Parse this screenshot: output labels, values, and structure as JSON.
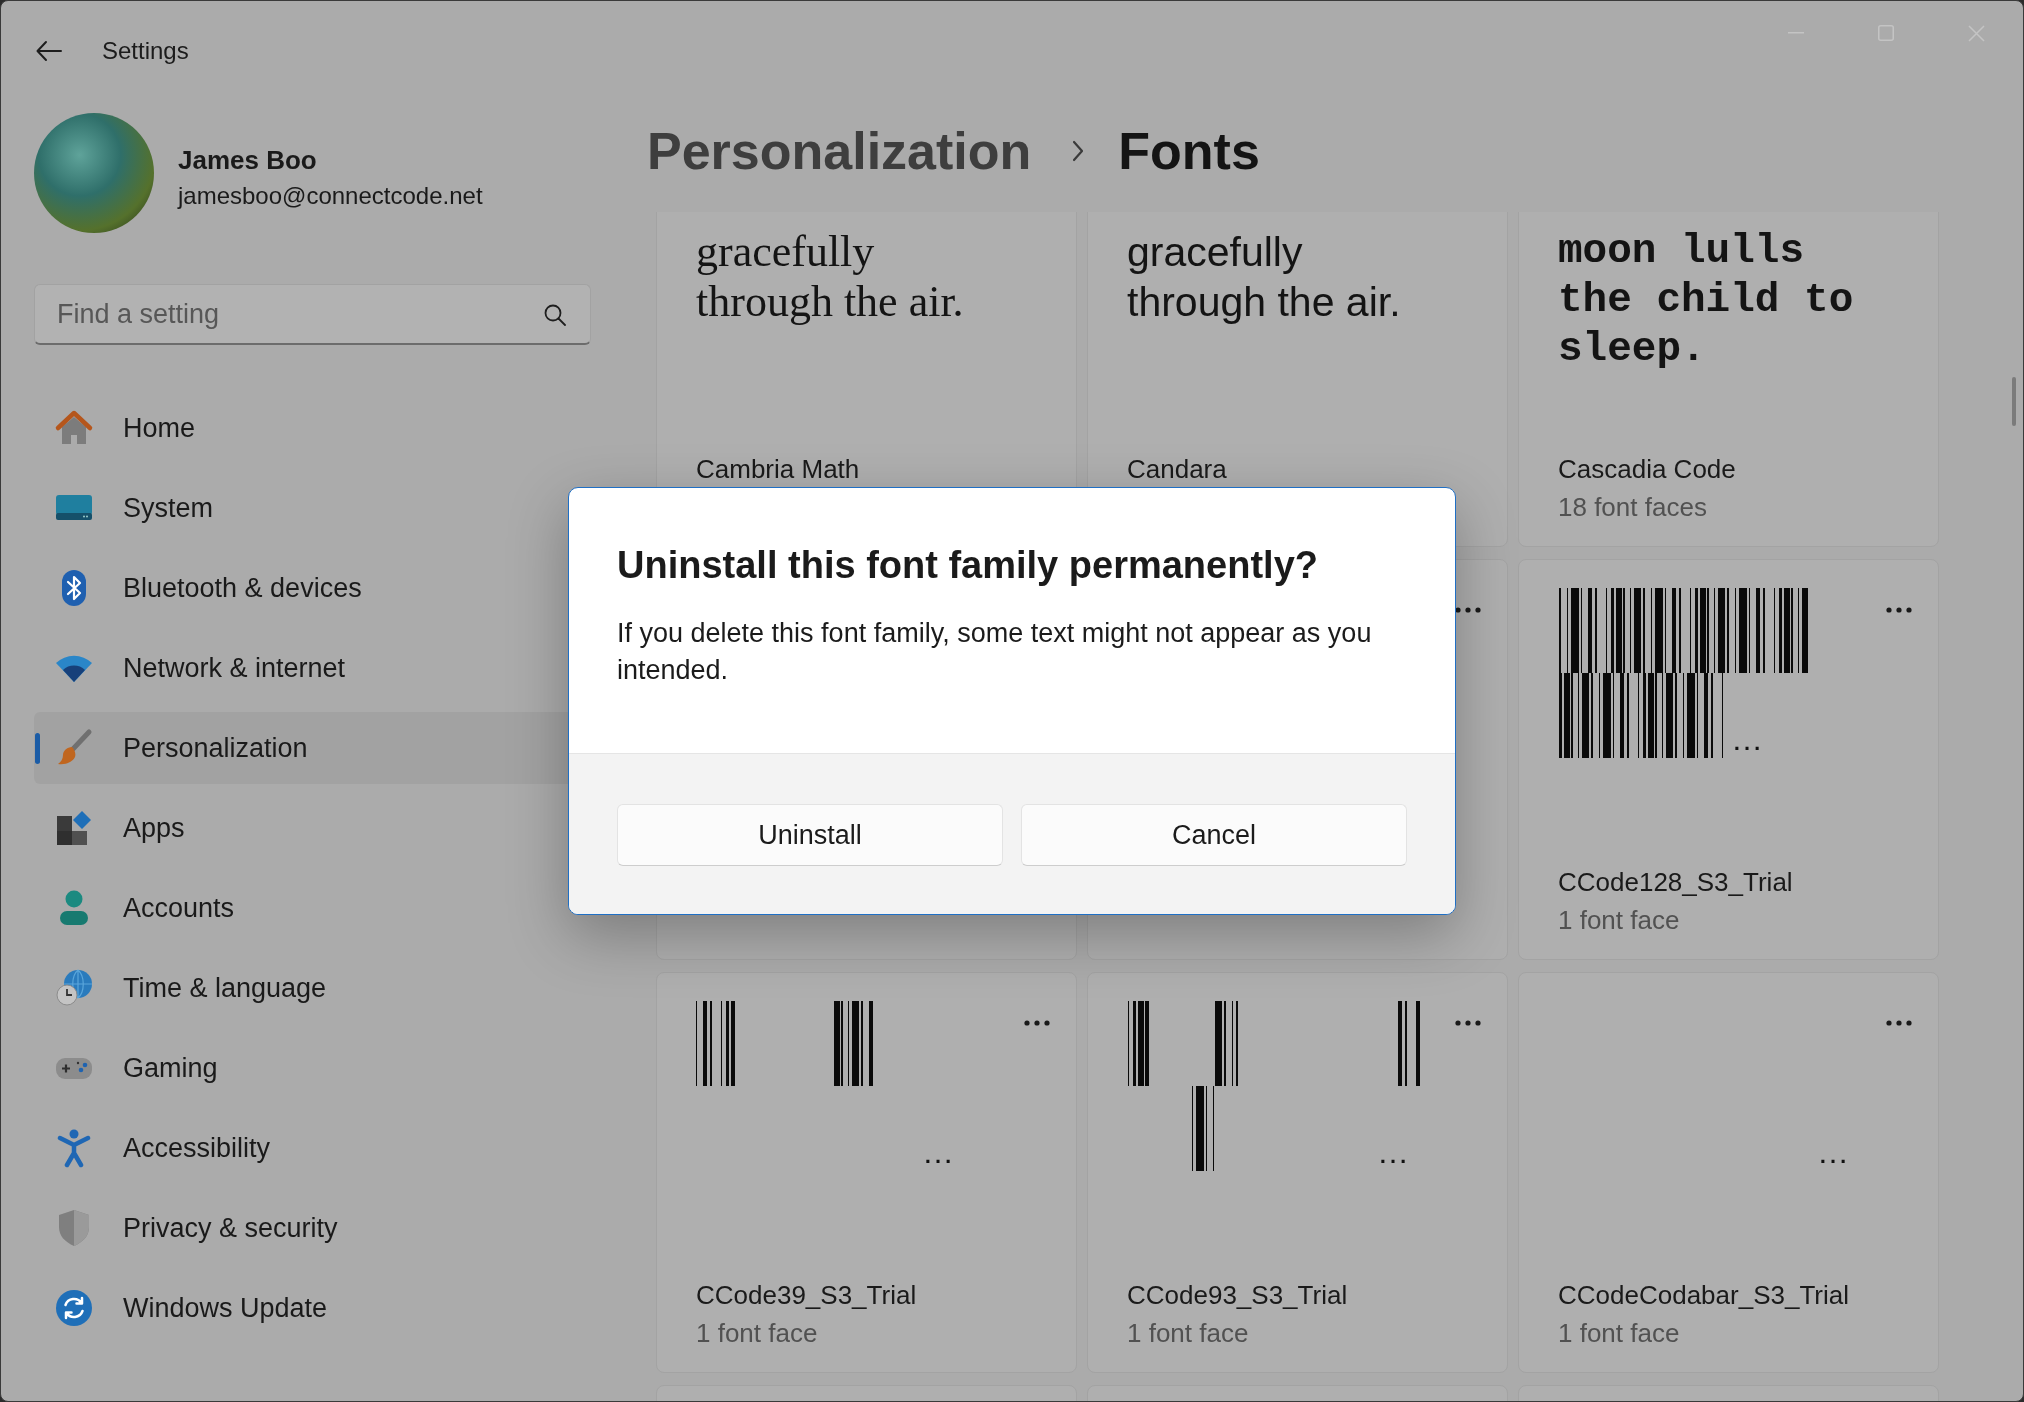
{
  "window": {
    "title": "Settings"
  },
  "profile": {
    "name": "James Boo",
    "email": "jamesboo@connectcode.net"
  },
  "search": {
    "placeholder": "Find a setting"
  },
  "sidebar": {
    "items": [
      {
        "label": "Home",
        "selected": false
      },
      {
        "label": "System",
        "selected": false
      },
      {
        "label": "Bluetooth & devices",
        "selected": false
      },
      {
        "label": "Network & internet",
        "selected": false
      },
      {
        "label": "Personalization",
        "selected": true
      },
      {
        "label": "Apps",
        "selected": false
      },
      {
        "label": "Accounts",
        "selected": false
      },
      {
        "label": "Time & language",
        "selected": false
      },
      {
        "label": "Gaming",
        "selected": false
      },
      {
        "label": "Accessibility",
        "selected": false
      },
      {
        "label": "Privacy & security",
        "selected": false
      },
      {
        "label": "Windows Update",
        "selected": false
      }
    ]
  },
  "breadcrumb": [
    {
      "label": "Personalization",
      "current": false
    },
    {
      "label": "Fonts",
      "current": true
    }
  ],
  "font_cards": [
    {
      "kind": "font",
      "preview": {
        "kind": "serif",
        "text": "gracefully\nthrough the air."
      },
      "name": "Cambria Math"
    },
    {
      "kind": "font",
      "preview": {
        "kind": "sans",
        "text": "gracefully\nthrough the air."
      },
      "name": "Candara"
    },
    {
      "kind": "font",
      "preview": {
        "kind": "mono",
        "text": "moon lulls\nthe child to\nsleep."
      },
      "name": "Cascadia Code",
      "faces": "18 font faces"
    },
    {
      "kind": "font"
    },
    {
      "kind": "font",
      "menu_button": true
    },
    {
      "kind": "font",
      "menu_button": true,
      "preview": {
        "kind": "barcode",
        "overflow": "…"
      },
      "name": "CCode128_S3_Trial",
      "faces": "1 font face"
    },
    {
      "kind": "font",
      "menu_button": true,
      "preview": {
        "kind": "barcode",
        "overflow": "…"
      },
      "name": "CCode39_S3_Trial",
      "faces": "1 font face"
    },
    {
      "kind": "font",
      "menu_button": true,
      "preview": {
        "kind": "barcode",
        "overflow": "…"
      },
      "name": "CCode93_S3_Trial",
      "faces": "1 font face"
    },
    {
      "kind": "font",
      "menu_button": true,
      "preview": {
        "kind": "barcode",
        "overflow": "…"
      },
      "name": "CCodeCodabar_S3_Trial",
      "faces": "1 font face"
    },
    {
      "kind": "font"
    },
    {
      "kind": "font"
    },
    {
      "kind": "font"
    }
  ],
  "dialog": {
    "title": "Uninstall this font family permanently?",
    "message": "If you delete this font family, some text might not appear as you intended.",
    "buttons": [
      {
        "label": "Uninstall"
      },
      {
        "label": "Cancel"
      }
    ]
  }
}
